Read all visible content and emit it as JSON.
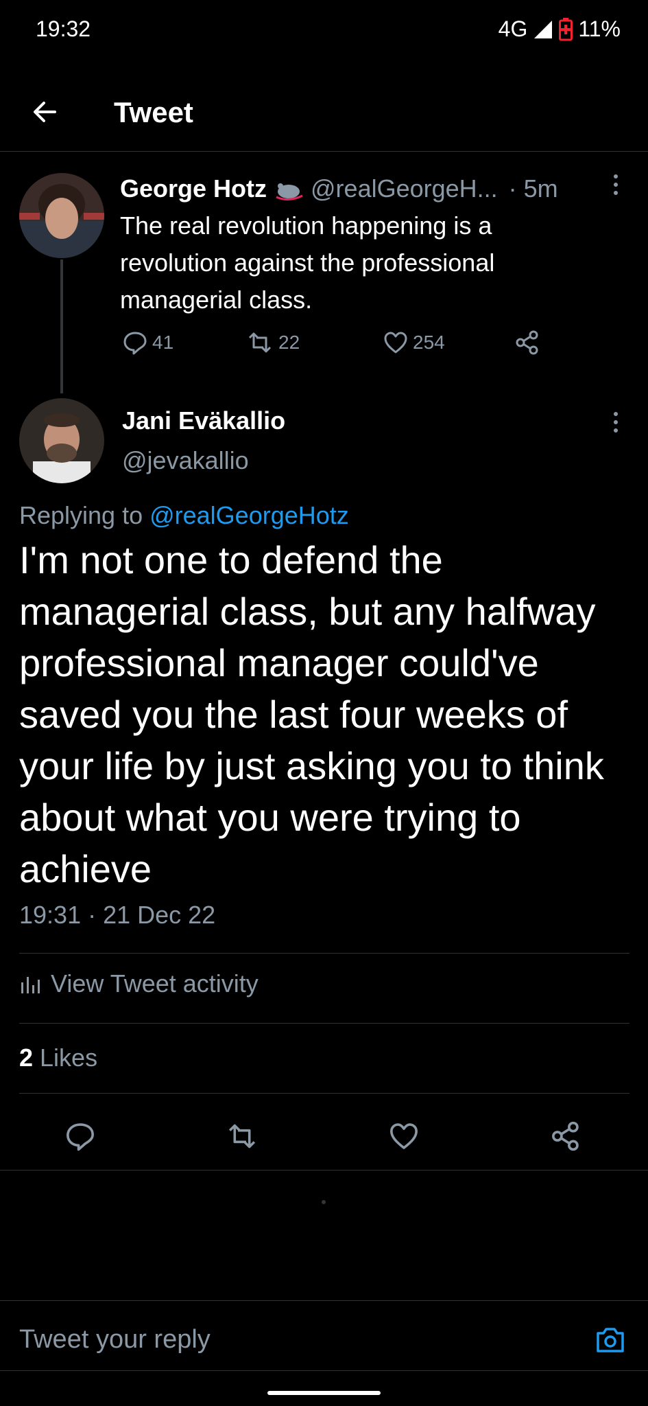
{
  "status_bar": {
    "time": "19:32",
    "network": "4G",
    "battery": "11%"
  },
  "header": {
    "title": "Tweet"
  },
  "parent_tweet": {
    "name": "George Hotz",
    "handle": "@realGeorgeH...",
    "time": "· 5m",
    "text": "The real revolution happening is a revolution against the professional managerial class.",
    "replies": "41",
    "retweets": "22",
    "likes": "254"
  },
  "tweet": {
    "name": "Jani Eväkallio",
    "handle": "@jevakallio",
    "replying_prefix": "Replying to ",
    "replying_to": "@realGeorgeHotz",
    "text": "I'm not one to defend the managerial class, but any halfway professional manager could've saved you the last four weeks of your life by just asking you to think about what you were trying to achieve",
    "timestamp": "19:31 · 21 Dec 22",
    "activity_label": "View Tweet activity",
    "likes_count": "2",
    "likes_label": " Likes"
  },
  "reply_box": {
    "placeholder": "Tweet your reply"
  },
  "colors": {
    "accent": "#1d9bf0",
    "muted": "#8b98a5",
    "battery_low": "#f4212e"
  }
}
